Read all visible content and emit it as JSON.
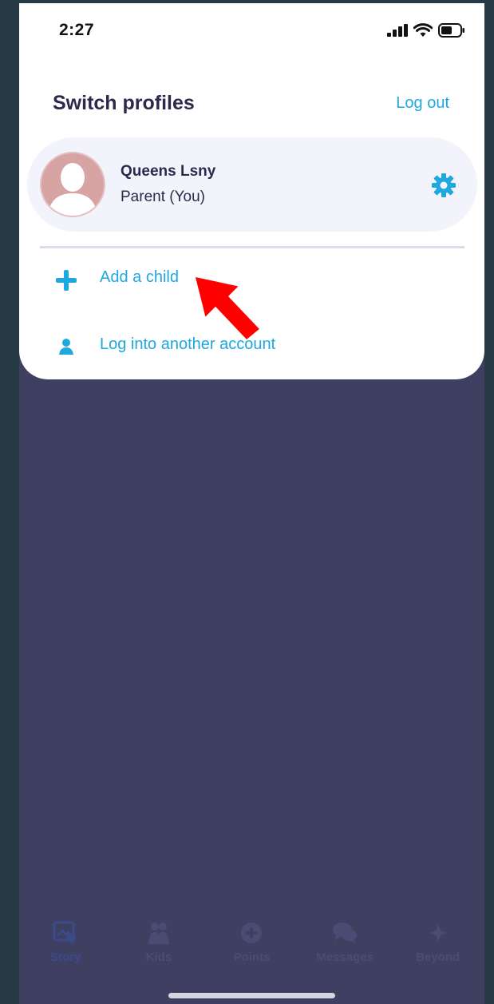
{
  "status_bar": {
    "time": "2:27",
    "icons": [
      "signal-icon",
      "wifi-icon",
      "battery-icon"
    ]
  },
  "sheet": {
    "title": "Switch profiles",
    "logout_label": "Log out",
    "profile": {
      "name": "Queens Lsny",
      "role": "Parent (You)"
    },
    "menu": [
      {
        "label": "Add a child",
        "icon": "plus-icon"
      },
      {
        "label": "Log into another account",
        "icon": "person-icon"
      }
    ]
  },
  "tabbar": {
    "tabs": [
      {
        "label": "Story",
        "icon": "story-icon",
        "active": true
      },
      {
        "label": "Kids",
        "icon": "kids-icon",
        "active": false
      },
      {
        "label": "Points",
        "icon": "points-icon",
        "active": false
      },
      {
        "label": "Messages",
        "icon": "messages-icon",
        "active": false
      },
      {
        "label": "Beyond",
        "icon": "beyond-icon",
        "active": false
      }
    ]
  },
  "colors": {
    "accent": "#1ea8e0",
    "title": "#2b2a4c",
    "overlay": "#3f3f61",
    "annotation_arrow": "#ff0000"
  }
}
